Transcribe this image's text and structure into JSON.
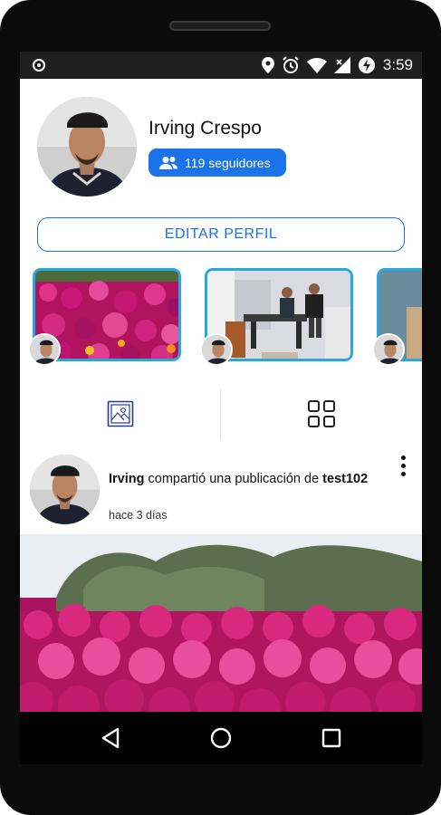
{
  "status_bar": {
    "time": "3:59",
    "icons": [
      "notification-dot-icon",
      "location-icon",
      "alarm-icon",
      "wifi-icon",
      "signal-icon",
      "battery-icon"
    ]
  },
  "profile": {
    "name": "Irving Crespo",
    "followers_label": "119 seguidores",
    "followers_icon": "people-icon",
    "edit_button": "EDITAR PERFIL"
  },
  "stories": {
    "items": [
      {
        "thumbnail": "pink-flowers"
      },
      {
        "thumbnail": "office-room"
      },
      {
        "thumbnail": "partial-blue"
      }
    ]
  },
  "tabs": {
    "items": [
      {
        "icon": "image-icon",
        "name": "photos"
      },
      {
        "icon": "grid-icon",
        "name": "grid"
      }
    ]
  },
  "post": {
    "author": "Irving",
    "action": " compartió una publicación de ",
    "source_user": "test102",
    "time_ago": "hace 3 días"
  },
  "nav": {
    "buttons": [
      "back-icon",
      "home-icon",
      "recents-icon"
    ]
  },
  "colors": {
    "accent": "#1a73e8",
    "story_border": "#29a8e0",
    "status_bar": "#1f1f1f"
  }
}
